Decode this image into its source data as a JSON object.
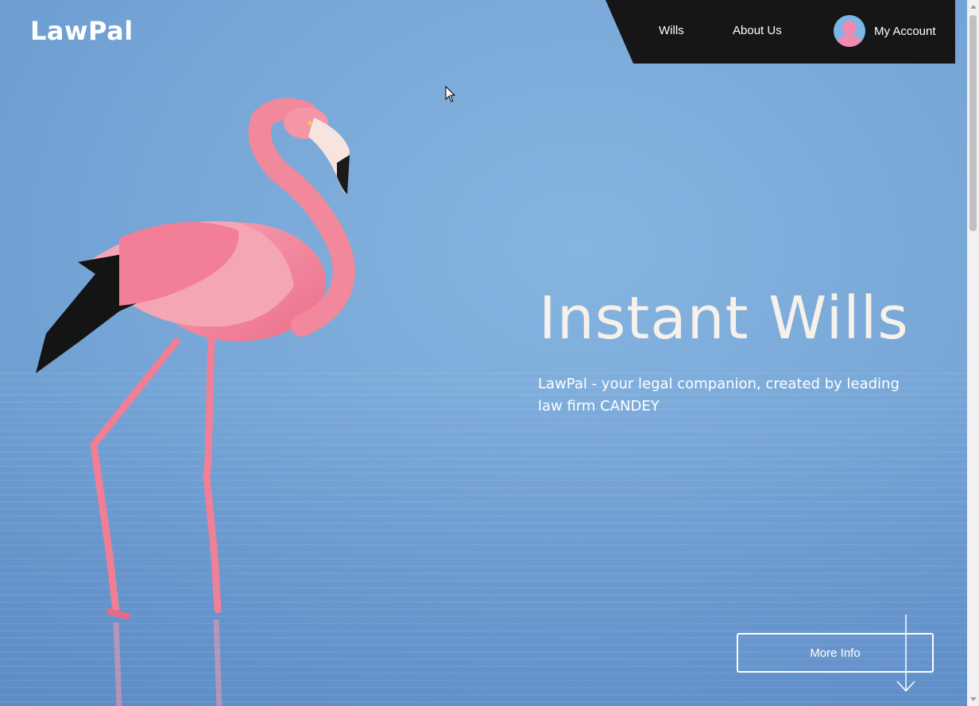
{
  "brand": {
    "logo": "LawPal"
  },
  "nav": {
    "items": [
      {
        "label": "Wills"
      },
      {
        "label": "About Us"
      }
    ],
    "account_label": "My Account"
  },
  "hero": {
    "headline": "Instant Wills",
    "subtitle": "LawPal - your legal companion, created by leading law firm CANDEY",
    "cta_label": "More Info"
  },
  "colors": {
    "nav_background": "#161616",
    "headline": "#f6f1ea",
    "sky": "#78a6d6",
    "flamingo": "#f08ab0",
    "avatar_bg": "#7ab6e6"
  },
  "icons": {
    "avatar": "avatar-icon",
    "cta_arrow": "arrow-down-icon",
    "cursor": "mouse-cursor"
  }
}
